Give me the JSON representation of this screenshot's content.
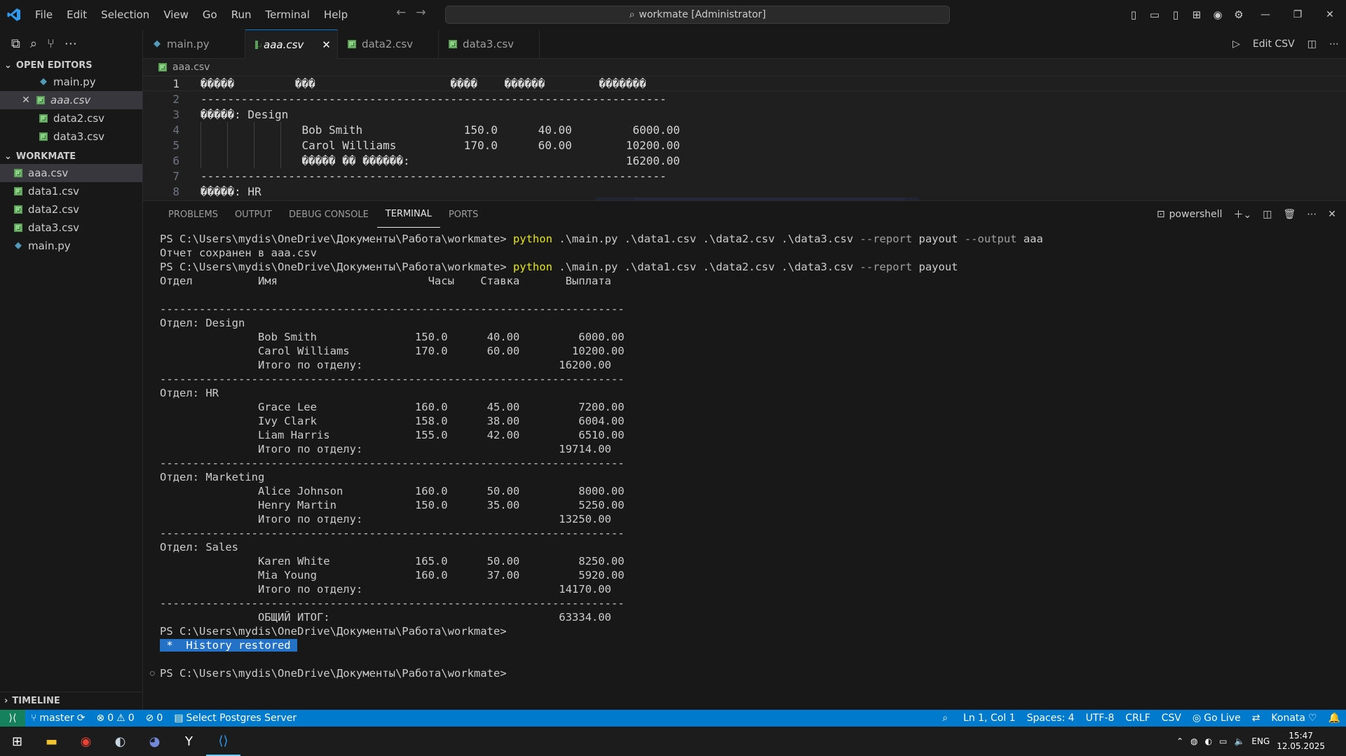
{
  "titlebar": {
    "menu": [
      "File",
      "Edit",
      "Selection",
      "View",
      "Go",
      "Run",
      "Terminal",
      "Help"
    ],
    "search_text": "workmate [Administrator]"
  },
  "sidebar": {
    "open_editors_title": "OPEN EDITORS",
    "open_editors": [
      {
        "label": "main.py",
        "type": "py"
      },
      {
        "label": "aaa.csv",
        "type": "csv"
      },
      {
        "label": "data2.csv",
        "type": "csv"
      },
      {
        "label": "data3.csv",
        "type": "csv"
      }
    ],
    "workspace_title": "WORKMATE",
    "files": [
      {
        "label": "aaa.csv",
        "type": "csv"
      },
      {
        "label": "data1.csv",
        "type": "csv"
      },
      {
        "label": "data2.csv",
        "type": "csv"
      },
      {
        "label": "data3.csv",
        "type": "csv"
      },
      {
        "label": "main.py",
        "type": "py"
      }
    ],
    "timeline_title": "TIMELINE"
  },
  "tabs": [
    {
      "label": "main.py",
      "type": "py"
    },
    {
      "label": "aaa.csv",
      "type": "csv"
    },
    {
      "label": "data2.csv",
      "type": "csv"
    },
    {
      "label": "data3.csv",
      "type": "csv"
    }
  ],
  "tab_actions": {
    "edit_csv": "Edit CSV"
  },
  "breadcrumb": "aaa.csv",
  "editor_lines": [
    {
      "n": "1",
      "text": "�����         ���                    ����    ������        �������"
    },
    {
      "n": "2",
      "text": "---------------------------------------------------------------------"
    },
    {
      "n": "3",
      "text": "�����: Design"
    },
    {
      "n": "4",
      "text": "               Bob Smith               150.0      40.00         6000.00"
    },
    {
      "n": "5",
      "text": "               Carol Williams          170.0      60.00        10200.00"
    },
    {
      "n": "6",
      "text": "               ����� �� ������:                                16200.00"
    },
    {
      "n": "7",
      "text": "---------------------------------------------------------------------"
    },
    {
      "n": "8",
      "text": "�����: HR"
    }
  ],
  "panel": {
    "tabs": [
      "PROBLEMS",
      "OUTPUT",
      "DEBUG CONSOLE",
      "TERMINAL",
      "PORTS"
    ],
    "shell": "powershell"
  },
  "terminal": {
    "prompt": "PS C:\\Users\\mydis\\OneDrive\\Документы\\Работа\\workmate> ",
    "cmd1_kw": "python",
    "cmd1_args": " .\\main.py .\\data1.csv .\\data2.csv .\\data3.csv ",
    "cmd1_flags": "--report",
    "cmd1_val": " payout ",
    "cmd1_flag2": "--output",
    "cmd1_val2": " aaa",
    "saved_msg": "Отчет сохранен в aaa.csv",
    "cmd2_kw": "python",
    "cmd2_args": " .\\main.py .\\data1.csv .\\data2.csv .\\data3.csv ",
    "cmd2_flags": "--report",
    "cmd2_val": " payout",
    "lines": [
      "Отдел          Имя                       Часы    Ставка       Выплата",
      "",
      "-----------------------------------------------------------------------",
      "Отдел: Design",
      "               Bob Smith               150.0      40.00         6000.00",
      "               Carol Williams          170.0      60.00        10200.00",
      "               Итого по отделу:                              16200.00",
      "-----------------------------------------------------------------------",
      "Отдел: HR",
      "               Grace Lee               160.0      45.00         7200.00",
      "               Ivy Clark               158.0      38.00         6004.00",
      "               Liam Harris             155.0      42.00         6510.00",
      "               Итого по отделу:                              19714.00",
      "-----------------------------------------------------------------------",
      "Отдел: Marketing",
      "               Alice Johnson           160.0      50.00         8000.00",
      "               Henry Martin            150.0      35.00         5250.00",
      "               Итого по отделу:                              13250.00",
      "-----------------------------------------------------------------------",
      "Отдел: Sales",
      "               Karen White             165.0      50.00         8250.00",
      "               Mia Young               160.0      37.00         5920.00",
      "               Итого по отделу:                              14170.00",
      "-----------------------------------------------------------------------",
      "               ОБЩИЙ ИТОГ:                                   63334.00"
    ],
    "history": " *  History restored "
  },
  "statusbar": {
    "branch": "master",
    "errors": "0",
    "warnings": "0",
    "ports": "0",
    "postgres": "Select Postgres Server",
    "position": "Ln 1, Col 1",
    "spaces": "Spaces: 4",
    "encoding": "UTF-8",
    "eol": "CRLF",
    "language": "CSV",
    "golive": "Go Live",
    "theme": "Konata"
  },
  "taskbar": {
    "lang": "ENG",
    "time": "15:47",
    "date": "12.05.2025"
  },
  "colors": {
    "accent": "#007acc",
    "keyword": "#e5e510",
    "history_bg": "#2472c8"
  }
}
